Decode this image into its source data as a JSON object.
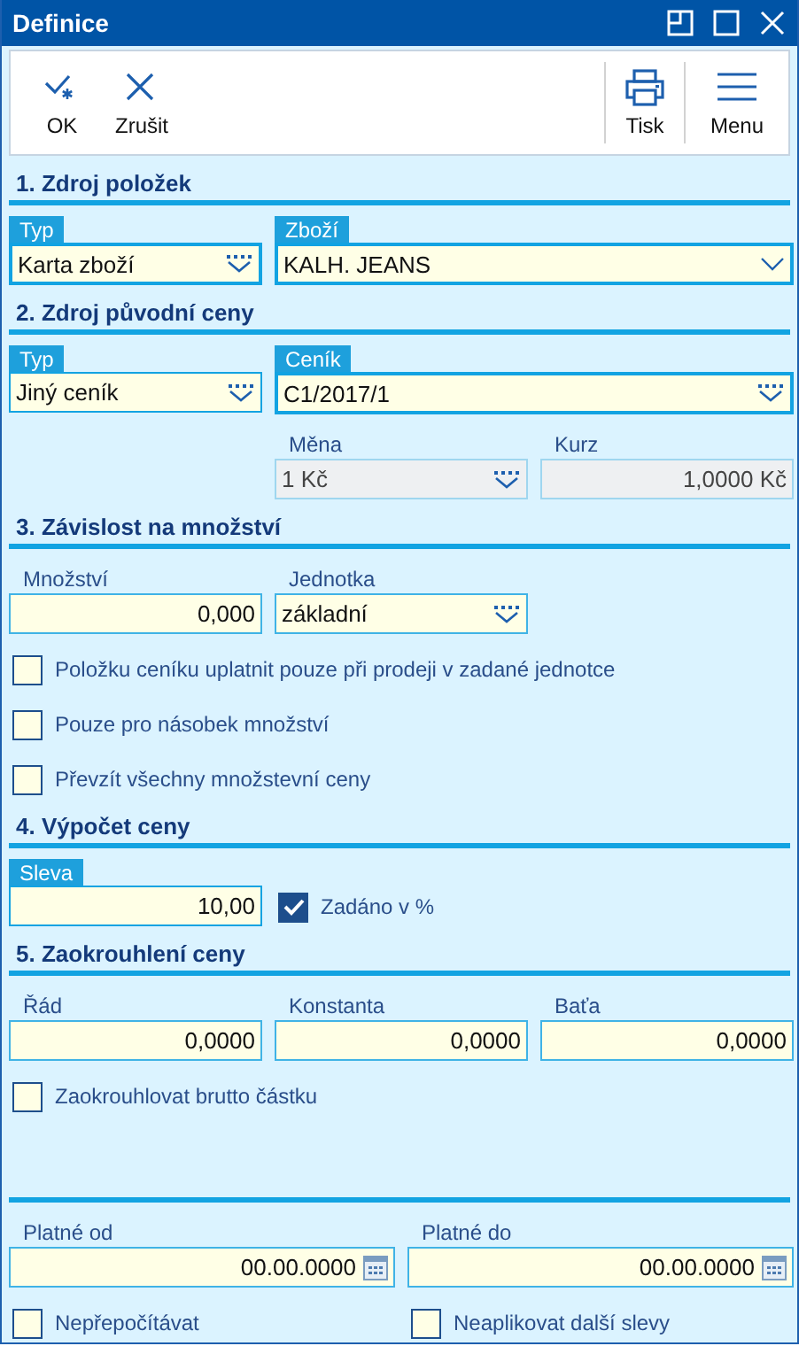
{
  "window": {
    "title": "Definice"
  },
  "toolbar": {
    "start": [
      {
        "label": "OK"
      },
      {
        "label": "Zrušit"
      }
    ],
    "end": [
      {
        "label": "Tisk"
      },
      {
        "label": "Menu"
      }
    ]
  },
  "sections": [
    {
      "title": "1. Zdroj položek",
      "rows": [
        {
          "kind": "wide-right",
          "items": [
            {
              "kind": "combo",
              "label": "Typ",
              "required": true,
              "highlighted": true,
              "value": "Karta zboží",
              "disabled": false
            },
            {
              "kind": "dropdown",
              "label": "Zboží",
              "required": true,
              "highlighted": true,
              "value": "KALH. JEANS",
              "disabled": false
            }
          ]
        }
      ]
    },
    {
      "title": "2. Zdroj původní ceny",
      "rows": [
        {
          "kind": "wide-right",
          "items": [
            {
              "kind": "combo",
              "label": "Typ",
              "required": true,
              "highlighted": false,
              "value": "Jiný ceník",
              "disabled": false
            },
            {
              "kind": "combo",
              "label": "Ceník",
              "required": true,
              "highlighted": true,
              "value": "C1/2017/1",
              "disabled": false
            }
          ]
        },
        {
          "kind": "offset",
          "items": [
            {
              "kind": "combo",
              "label": "Měna",
              "required": false,
              "highlighted": false,
              "value": "1 Kč",
              "disabled": true
            },
            {
              "kind": "number",
              "label": "Kurz",
              "required": false,
              "highlighted": false,
              "value": "1,0000 Kč",
              "disabled": true
            }
          ]
        }
      ]
    },
    {
      "title": "3. Závislost na množství",
      "rows": [
        {
          "kind": "left",
          "items": [
            {
              "kind": "number",
              "label": "Množství",
              "required": false,
              "highlighted": false,
              "value": "0,000",
              "disabled": false
            },
            {
              "kind": "combo",
              "label": "Jednotka",
              "required": false,
              "highlighted": false,
              "value": "základní",
              "disabled": false
            }
          ]
        },
        {
          "kind": "single",
          "items": [
            {
              "kind": "checkbox",
              "label": "Položku ceníku uplatnit pouze při prodeji v zadané jednotce",
              "checked": false
            }
          ]
        },
        {
          "kind": "single",
          "items": [
            {
              "kind": "checkbox",
              "label": "Pouze pro násobek množství",
              "checked": false
            }
          ]
        },
        {
          "kind": "single",
          "items": [
            {
              "kind": "checkbox",
              "label": "Převzít všechny množstevní ceny",
              "checked": false
            }
          ]
        }
      ]
    },
    {
      "title": "4. Výpočet ceny",
      "rows": [
        {
          "kind": "left",
          "items": [
            {
              "kind": "number",
              "label": "Sleva",
              "required": true,
              "highlighted": false,
              "value": "10,00",
              "disabled": false
            },
            {
              "kind": "checkbox",
              "label": "Zadáno v %",
              "checked": true
            }
          ]
        }
      ]
    },
    {
      "title": "5. Zaokrouhlení ceny",
      "rows": [
        {
          "kind": "thirds",
          "items": [
            {
              "kind": "number",
              "label": "Řád",
              "required": false,
              "highlighted": false,
              "value": "0,0000",
              "disabled": false
            },
            {
              "kind": "number",
              "label": "Konstanta",
              "required": false,
              "highlighted": false,
              "value": "0,0000",
              "disabled": false
            },
            {
              "kind": "number",
              "label": "Baťa",
              "required": false,
              "highlighted": false,
              "value": "0,0000",
              "disabled": false
            }
          ]
        },
        {
          "kind": "single",
          "items": [
            {
              "kind": "checkbox",
              "label": "Zaokrouhlovat brutto částku",
              "checked": false
            }
          ]
        }
      ]
    },
    {
      "rows": [
        {
          "kind": "halves",
          "items": [
            {
              "kind": "date",
              "label": "Platné od",
              "required": false,
              "highlighted": false,
              "value": "00.00.0000",
              "disabled": false
            },
            {
              "kind": "date",
              "label": "Platné do",
              "required": false,
              "highlighted": false,
              "value": "00.00.0000",
              "disabled": false
            }
          ]
        },
        {
          "kind": "halves",
          "items": [
            {
              "kind": "checkbox",
              "label": "Nepřepočítávat",
              "checked": false
            },
            {
              "kind": "checkbox",
              "label": "Neaplikovat další slevy",
              "checked": false
            }
          ]
        }
      ]
    }
  ]
}
